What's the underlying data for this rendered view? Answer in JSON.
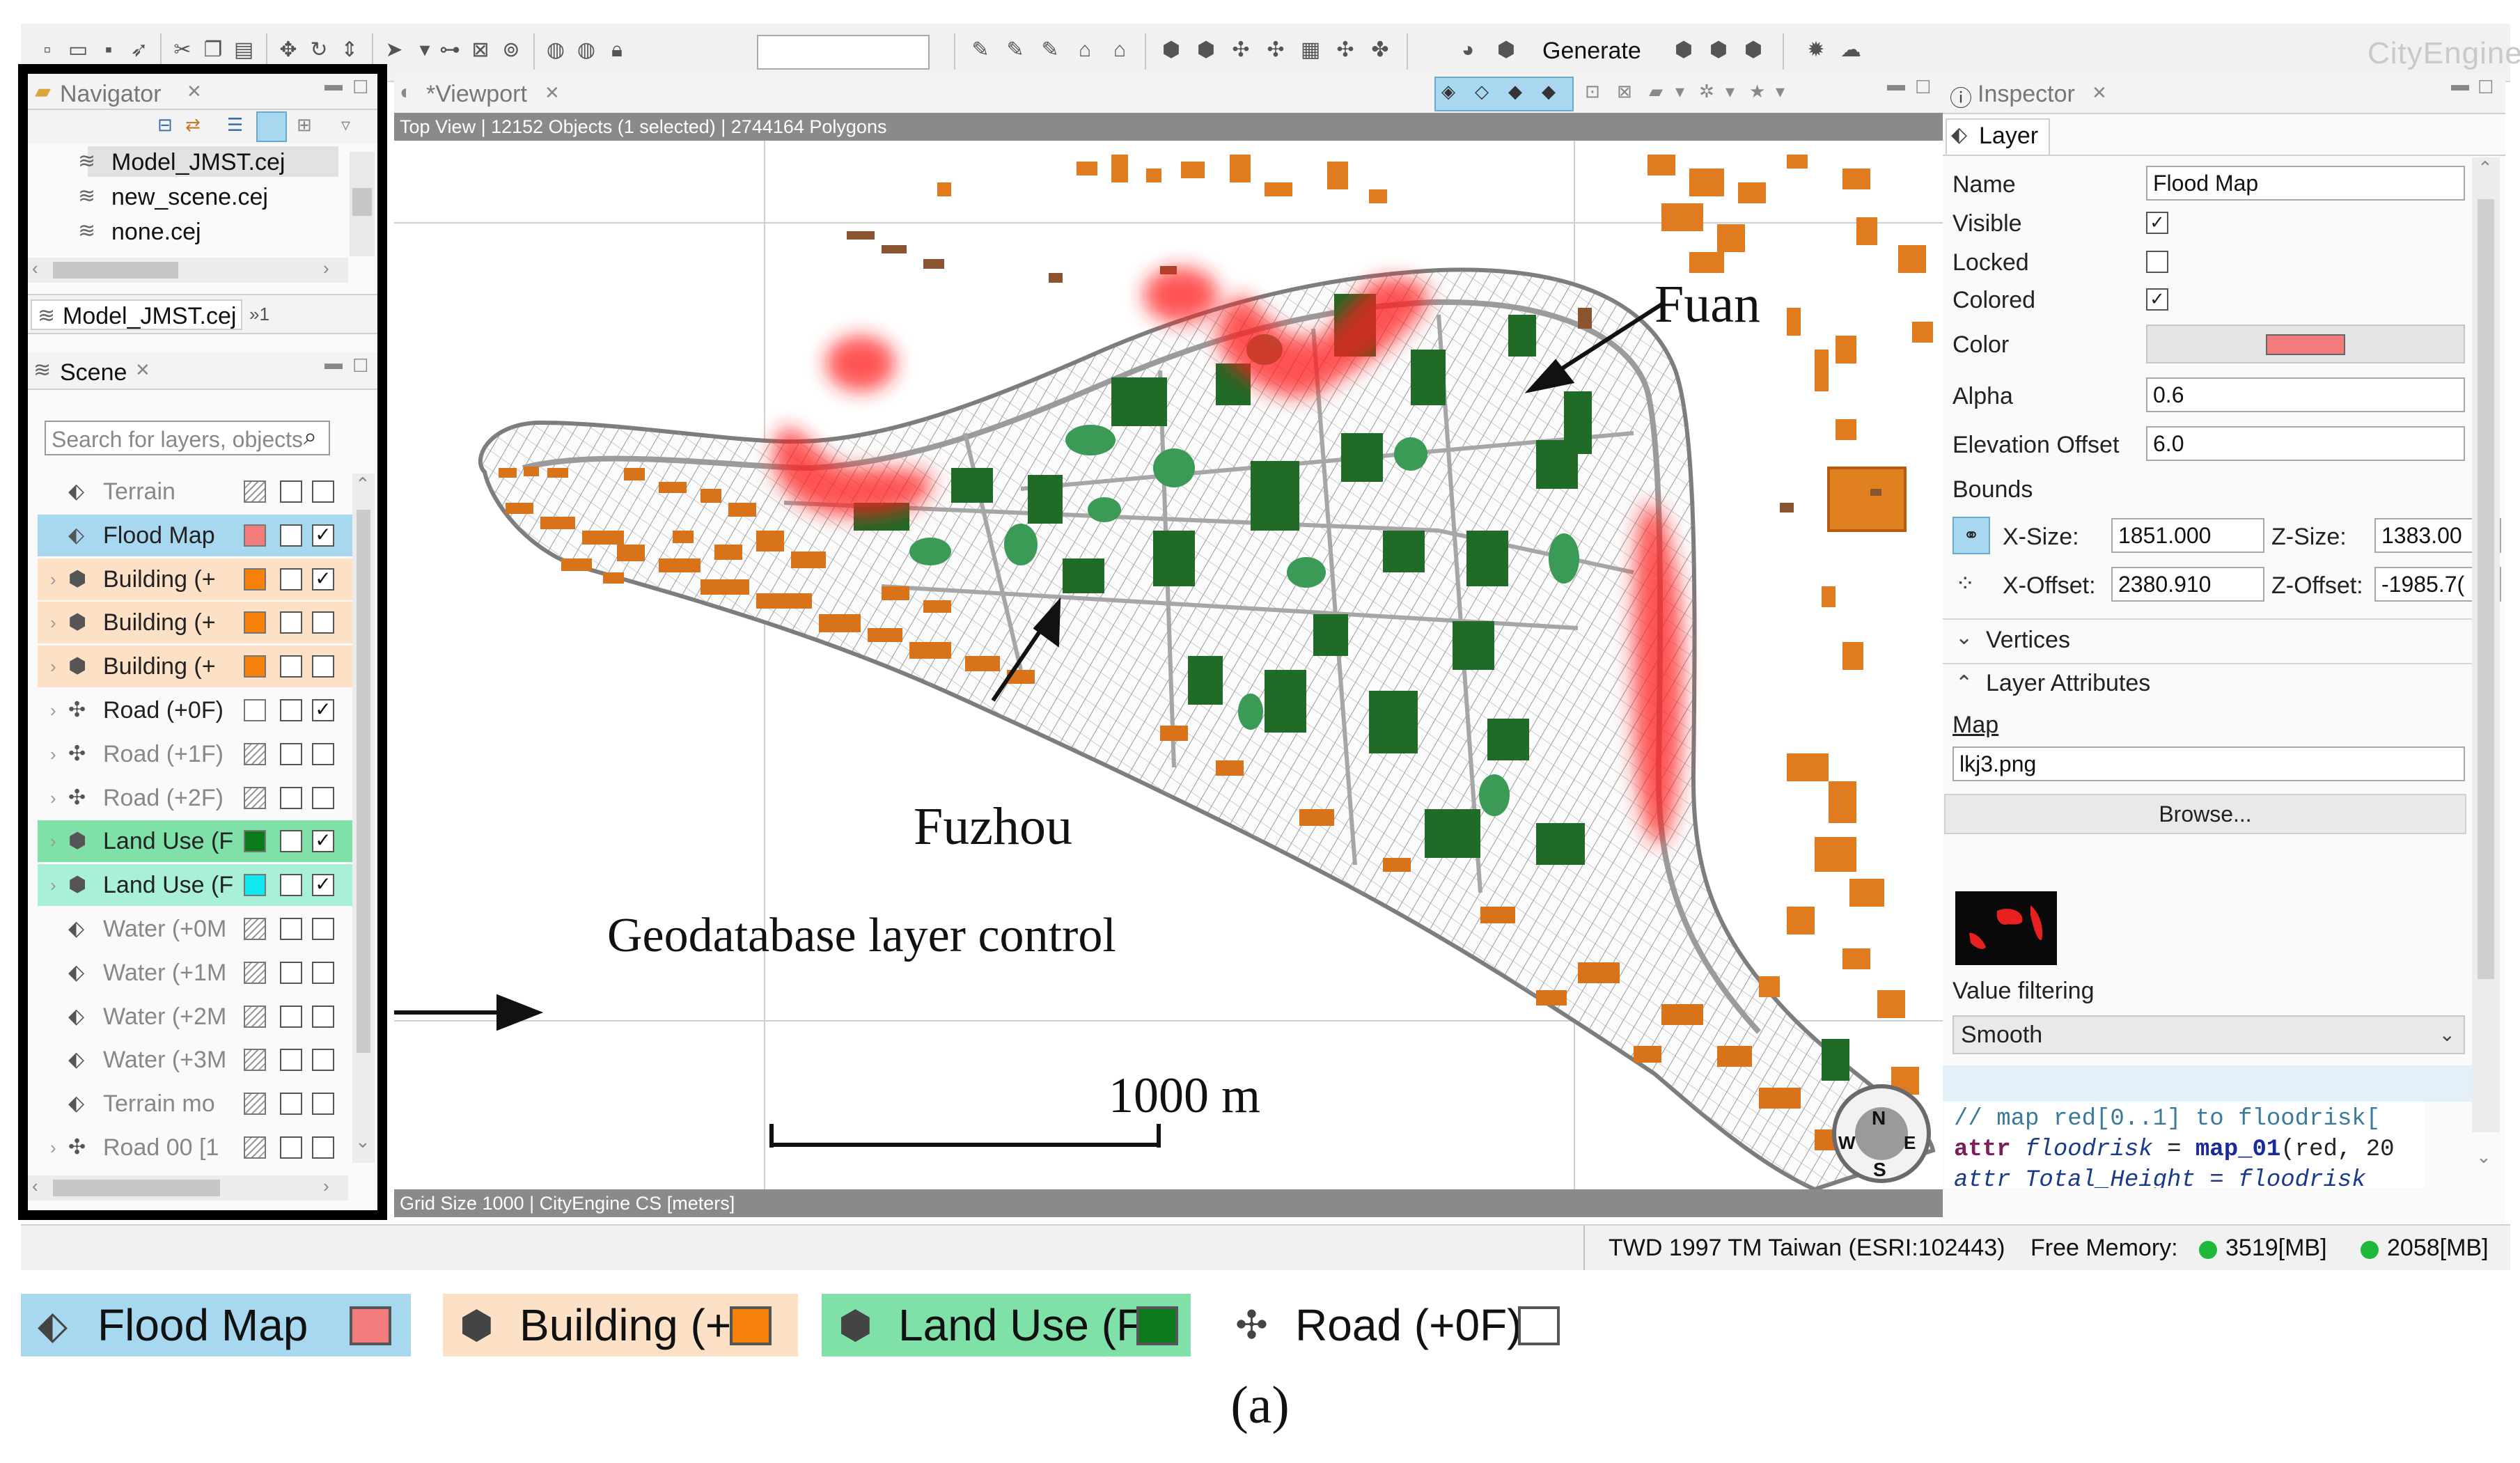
{
  "app": {
    "brand": "CityEngine"
  },
  "toolbar": {
    "generate_label": "Generate",
    "search_value": ""
  },
  "navigator": {
    "title": "Navigator",
    "files": [
      "Model_JMST.cej",
      "new_scene.cej",
      "none.cej"
    ],
    "open_scene_tab": "Model_JMST.cej",
    "overflow_tab": "»1"
  },
  "scene": {
    "title": "Scene",
    "search_placeholder": "Search for layers, objects",
    "layers": [
      {
        "name": "Terrain",
        "icon": "terrain-icon",
        "swatch": null,
        "hatch": true,
        "locked": false,
        "visible": false,
        "highlight": "",
        "expandable": false
      },
      {
        "name": "Flood Map",
        "icon": "map-layer-icon",
        "swatch": "#f27c7c",
        "hatch": false,
        "locked": false,
        "visible": true,
        "highlight": "#a8d8f0",
        "expandable": false
      },
      {
        "name": "Building (+",
        "icon": "shape-layer-icon",
        "swatch": "#f5800a",
        "hatch": false,
        "locked": false,
        "visible": true,
        "highlight": "#fde1c7",
        "expandable": true
      },
      {
        "name": "Building (+",
        "icon": "shape-layer-icon",
        "swatch": "#f5800a",
        "hatch": false,
        "locked": false,
        "visible": false,
        "highlight": "#fde1c7",
        "expandable": true
      },
      {
        "name": "Building (+",
        "icon": "shape-layer-icon",
        "swatch": "#f5800a",
        "hatch": false,
        "locked": false,
        "visible": false,
        "highlight": "#fde1c7",
        "expandable": true
      },
      {
        "name": "Road (+0F)",
        "icon": "graph-layer-icon",
        "swatch": "#ffffff",
        "hatch": false,
        "locked": false,
        "visible": true,
        "highlight": "",
        "expandable": true
      },
      {
        "name": "Road (+1F)",
        "icon": "graph-layer-icon",
        "swatch": null,
        "hatch": true,
        "locked": false,
        "visible": false,
        "highlight": "",
        "expandable": true
      },
      {
        "name": "Road (+2F)",
        "icon": "graph-layer-icon",
        "swatch": null,
        "hatch": true,
        "locked": false,
        "visible": false,
        "highlight": "",
        "expandable": true
      },
      {
        "name": "Land Use (F",
        "icon": "shape-layer-icon",
        "swatch": "#0a7a1a",
        "hatch": false,
        "locked": false,
        "visible": true,
        "highlight": "#7fe0a8",
        "expandable": true
      },
      {
        "name": "Land Use (F",
        "icon": "shape-layer-icon",
        "swatch": "#10e8f0",
        "hatch": false,
        "locked": false,
        "visible": true,
        "highlight": "#a8f0d8",
        "expandable": true
      },
      {
        "name": "Water (+0M",
        "icon": "terrain-icon",
        "swatch": null,
        "hatch": true,
        "locked": false,
        "visible": false,
        "highlight": "",
        "expandable": false
      },
      {
        "name": "Water (+1M",
        "icon": "terrain-icon",
        "swatch": null,
        "hatch": true,
        "locked": false,
        "visible": false,
        "highlight": "",
        "expandable": false
      },
      {
        "name": "Water (+2M",
        "icon": "terrain-icon",
        "swatch": null,
        "hatch": true,
        "locked": false,
        "visible": false,
        "highlight": "",
        "expandable": false
      },
      {
        "name": "Water (+3M",
        "icon": "terrain-icon",
        "swatch": null,
        "hatch": true,
        "locked": false,
        "visible": false,
        "highlight": "",
        "expandable": false
      },
      {
        "name": "Terrain mo",
        "icon": "terrain-icon",
        "swatch": null,
        "hatch": true,
        "locked": false,
        "visible": false,
        "highlight": "",
        "expandable": false
      },
      {
        "name": "Road 00 [1",
        "icon": "graph-layer-icon",
        "swatch": null,
        "hatch": true,
        "locked": false,
        "visible": false,
        "highlight": "",
        "expandable": true
      }
    ]
  },
  "viewport": {
    "title": "*Viewport",
    "status": "Top View  |  12152 Objects  (1 selected)  |  2744164 Polygons",
    "footer": "Grid Size 1000  |  CityEngine CS [meters]",
    "annotations": {
      "fuan": "Fuan",
      "fuzhou": "Fuzhou",
      "geodatabase": "Geodatabase layer control",
      "scale": "1000 m"
    },
    "compass": {
      "n": "N",
      "s": "S",
      "e": "E",
      "w": "W"
    }
  },
  "inspector": {
    "title": "Inspector",
    "tab": "Layer",
    "name_label": "Name",
    "name_value": "Flood Map",
    "visible_label": "Visible",
    "visible_checked": true,
    "locked_label": "Locked",
    "locked_checked": false,
    "colored_label": "Colored",
    "colored_checked": true,
    "color_label": "Color",
    "color_value": "#f27c7c",
    "alpha_label": "Alpha",
    "alpha_value": "0.6",
    "elevation_label": "Elevation Offset",
    "elevation_value": "6.0",
    "bounds_label": "Bounds",
    "xsize_label": "X-Size:",
    "xsize_value": "1851.000",
    "zsize_label": "Z-Size:",
    "zsize_value": "1383.00",
    "xoffset_label": "X-Offset:",
    "xoffset_value": "2380.910",
    "zoffset_label": "Z-Offset:",
    "zoffset_value": "-1985.7(",
    "vertices_label": "Vertices",
    "attributes_label": "Layer Attributes",
    "map_label": "Map",
    "map_value": "lkj3.png",
    "browse_label": "Browse...",
    "filter_label": "Value filtering",
    "filter_value": "Smooth",
    "code_line1": "// map red[0..1] to floodrisk[",
    "code_line2a": "attr ",
    "code_line2b": "floodrisk",
    "code_line2c": " = ",
    "code_line2d": "map_01",
    "code_line2e": "(red,",
    "code_line2f": " 20",
    "code_line3": "attr Total_Height = floodrisk"
  },
  "statusbar": {
    "crs": "TWD 1997 TM Taiwan (ESRI:102443)",
    "memory_label": "Free Memory:",
    "mem1": "3519[MB]",
    "mem2": "2058[MB]"
  },
  "legend": [
    {
      "name": "Flood Map",
      "bg": "#a8d8f0",
      "swatch": "#f27c7c",
      "icon": "map-layer-icon"
    },
    {
      "name": "Building (+",
      "bg": "#fde1c7",
      "swatch": "#f5800a",
      "icon": "shape-layer-icon"
    },
    {
      "name": "Land Use (F",
      "bg": "#7fe0a8",
      "swatch": "#0a7a1a",
      "icon": "shape-layer-icon"
    },
    {
      "name": "Road (+0F)",
      "bg": "#ffffff",
      "swatch": "#ffffff",
      "icon": "graph-layer-icon"
    }
  ],
  "caption": "(a)"
}
